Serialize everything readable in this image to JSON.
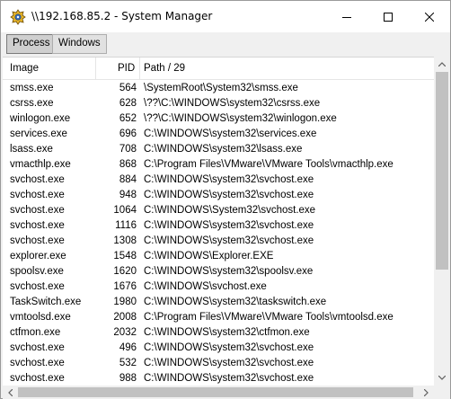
{
  "window": {
    "title": "\\\\192.168.85.2 - System Manager",
    "icon": "system-manager-app-icon"
  },
  "controls": {
    "minimize": "minimize-icon",
    "maximize": "maximize-icon",
    "close": "close-icon"
  },
  "tabs": [
    {
      "label": "Process",
      "active": true
    },
    {
      "label": "Windows",
      "active": false
    }
  ],
  "columns": {
    "image": "Image",
    "pid": "PID",
    "path": "Path / 29"
  },
  "processes": [
    {
      "image": "smss.exe",
      "pid": "564",
      "path": "\\SystemRoot\\System32\\smss.exe"
    },
    {
      "image": "csrss.exe",
      "pid": "628",
      "path": "\\??\\C:\\WINDOWS\\system32\\csrss.exe"
    },
    {
      "image": "winlogon.exe",
      "pid": "652",
      "path": "\\??\\C:\\WINDOWS\\system32\\winlogon.exe"
    },
    {
      "image": "services.exe",
      "pid": "696",
      "path": "C:\\WINDOWS\\system32\\services.exe"
    },
    {
      "image": "lsass.exe",
      "pid": "708",
      "path": "C:\\WINDOWS\\system32\\lsass.exe"
    },
    {
      "image": "vmacthlp.exe",
      "pid": "868",
      "path": "C:\\Program Files\\VMware\\VMware Tools\\vmacthlp.exe"
    },
    {
      "image": "svchost.exe",
      "pid": "884",
      "path": "C:\\WINDOWS\\system32\\svchost.exe"
    },
    {
      "image": "svchost.exe",
      "pid": "948",
      "path": "C:\\WINDOWS\\system32\\svchost.exe"
    },
    {
      "image": "svchost.exe",
      "pid": "1064",
      "path": "C:\\WINDOWS\\System32\\svchost.exe"
    },
    {
      "image": "svchost.exe",
      "pid": "1116",
      "path": "C:\\WINDOWS\\system32\\svchost.exe"
    },
    {
      "image": "svchost.exe",
      "pid": "1308",
      "path": "C:\\WINDOWS\\system32\\svchost.exe"
    },
    {
      "image": "explorer.exe",
      "pid": "1548",
      "path": "C:\\WINDOWS\\Explorer.EXE"
    },
    {
      "image": "spoolsv.exe",
      "pid": "1620",
      "path": "C:\\WINDOWS\\system32\\spoolsv.exe"
    },
    {
      "image": "svchost.exe",
      "pid": "1676",
      "path": "C:\\WINDOWS\\svchost.exe"
    },
    {
      "image": "TaskSwitch.exe",
      "pid": "1980",
      "path": "C:\\WINDOWS\\system32\\taskswitch.exe"
    },
    {
      "image": "vmtoolsd.exe",
      "pid": "2008",
      "path": "C:\\Program Files\\VMware\\VMware Tools\\vmtoolsd.exe"
    },
    {
      "image": "ctfmon.exe",
      "pid": "2032",
      "path": "C:\\WINDOWS\\system32\\ctfmon.exe"
    },
    {
      "image": "svchost.exe",
      "pid": "496",
      "path": "C:\\WINDOWS\\system32\\svchost.exe"
    },
    {
      "image": "svchost.exe",
      "pid": "532",
      "path": "C:\\WINDOWS\\system32\\svchost.exe"
    },
    {
      "image": "svchost.exe",
      "pid": "988",
      "path": "C:\\WINDOWS\\system32\\svchost.exe"
    }
  ],
  "colors": {
    "titlebar": "#ffffff",
    "frame": "#f0f0f0",
    "scroll_thumb": "#c1c1c1"
  }
}
